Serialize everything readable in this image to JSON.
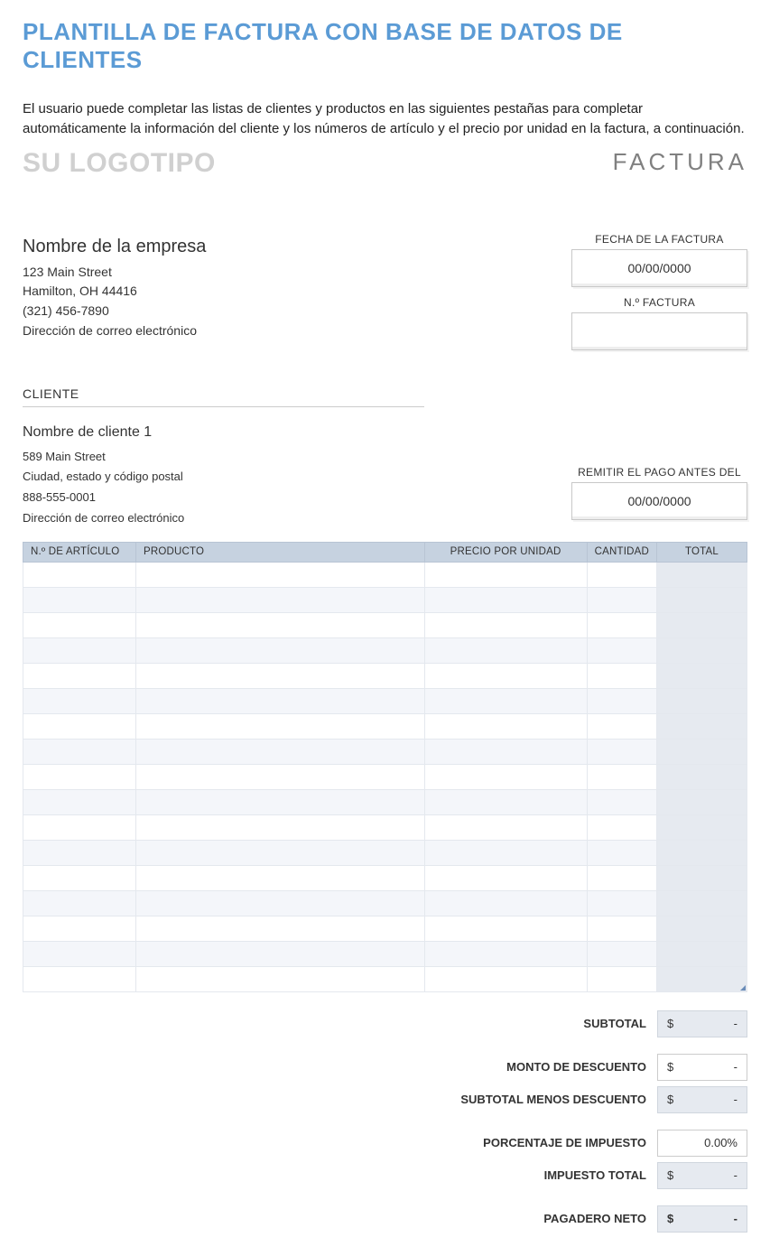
{
  "title": "PLANTILLA DE FACTURA CON BASE DE DATOS DE CLIENTES",
  "intro": "El usuario puede completar las listas de clientes y productos en las siguientes pestañas para completar automáticamente la información del cliente y los números de artículo y el precio por unidad en la factura, a continuación.",
  "logo_text": "SU LOGOTIPO",
  "doc_type": "FACTURA",
  "company": {
    "name": "Nombre de la empresa",
    "line1": "123 Main Street",
    "line2": "Hamilton, OH 44416",
    "phone": "(321) 456-7890",
    "email": "Dirección de correo electrónico"
  },
  "meta": {
    "invoice_date_label": "FECHA DE LA FACTURA",
    "invoice_date": "00/00/0000",
    "invoice_no_label": "N.º FACTURA",
    "invoice_no": ""
  },
  "client_header": "CLIENTE",
  "client": {
    "name": "Nombre de cliente 1",
    "line1": "589 Main Street",
    "line2": "Ciudad, estado y código postal",
    "phone": "888-555-0001",
    "email": "Dirección de correo electrónico"
  },
  "due": {
    "label": "REMITIR EL PAGO ANTES DEL",
    "value": "00/00/0000"
  },
  "columns": {
    "article": "N.º DE ARTÍCULO",
    "product": "PRODUCTO",
    "price": "PRECIO POR UNIDAD",
    "qty": "CANTIDAD",
    "total": "TOTAL"
  },
  "row_count": 17,
  "totals": {
    "subtotal_label": "SUBTOTAL",
    "discount_label": "MONTO DE DESCUENTO",
    "sub_minus_label": "SUBTOTAL MENOS DESCUENTO",
    "tax_pct_label": "PORCENTAJE DE IMPUESTO",
    "tax_pct_value": "0.00%",
    "tax_total_label": "IMPUESTO TOTAL",
    "net_label": "PAGADERO NETO",
    "currency": "$",
    "dash": "-"
  }
}
